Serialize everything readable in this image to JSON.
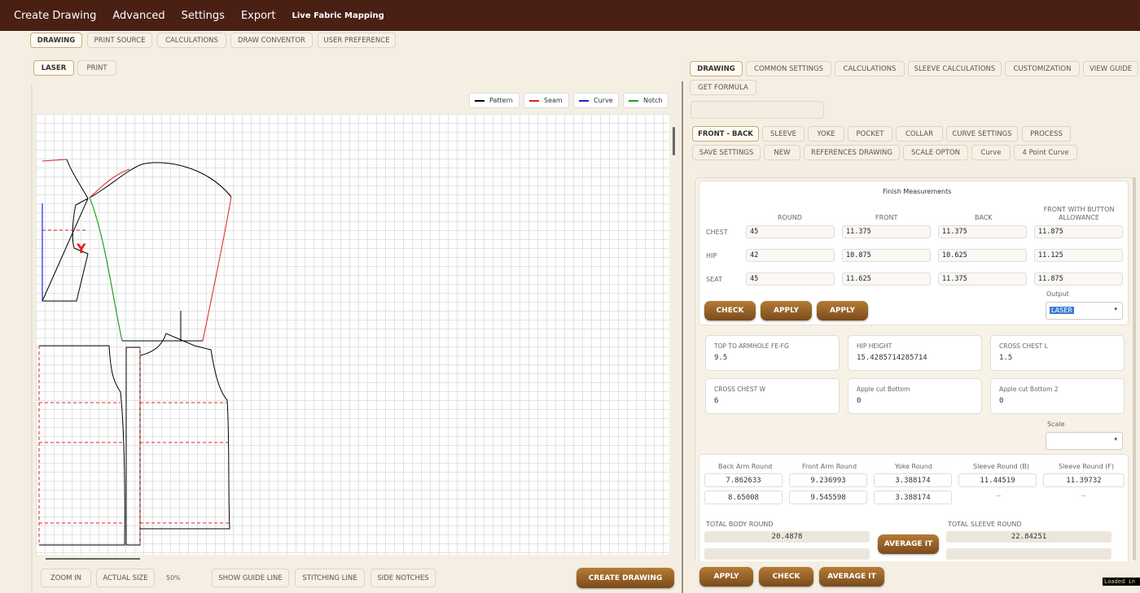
{
  "menu": {
    "create_drawing": "Create Drawing",
    "advanced": "Advanced",
    "settings": "Settings",
    "export": "Export",
    "live_fabric": "Live Fabric Mapping"
  },
  "top_tabs": [
    "DRAWING",
    "PRINT SOURCE",
    "CALCULATIONS",
    "DRAW CONVENTOR",
    "USER PREFERENCE"
  ],
  "mode_tabs": [
    "LASER",
    "PRINT"
  ],
  "legend": [
    "Pattern",
    "Seam",
    "Curve",
    "Notch"
  ],
  "legend_colors": {
    "pattern": "#000000",
    "seam": "#e02020",
    "curve": "#2020e0",
    "notch": "#20a020"
  },
  "drawing_marker": "Y",
  "bottom_bar": {
    "zoom_in": "ZOOM IN",
    "actual_size": "ACTUAL SIZE",
    "zoom": "50%",
    "show_guide": "SHOW GUIDE LINE",
    "stitching": "STITCHING LINE",
    "side_notches": "SIDE NOTCHES",
    "create": "CREATE DRAWING"
  },
  "right_tabs": [
    "DRAWING",
    "COMMON SETTINGS",
    "CALCULATIONS",
    "SLEEVE CALCULATIONS",
    "CUSTOMIZATION",
    "VIEW GUIDE",
    "GET FORMULA"
  ],
  "sub_tabs_row1": [
    "FRONT - BACK",
    "SLEEVE",
    "YOKE",
    "POCKET",
    "COLLAR",
    "CURVE SETTINGS",
    "PROCESS"
  ],
  "sub_tabs_row2": [
    "SAVE SETTINGS",
    "NEW",
    "REFERENCES DRAWING",
    "SCALE OPTON",
    "Curve",
    "4 Point Curve"
  ],
  "finish": {
    "title": "Finish Measurements",
    "headers": [
      "ROUND",
      "FRONT",
      "BACK",
      "FRONT WITH BUTTON ALLOWANCE"
    ],
    "rows": [
      {
        "label": "CHEST",
        "values": [
          "45",
          "11.375",
          "11.375",
          "11.875"
        ]
      },
      {
        "label": "HIP",
        "values": [
          "42",
          "10.875",
          "10.625",
          "11.125"
        ]
      },
      {
        "label": "SEAT",
        "values": [
          "45",
          "11.625",
          "11.375",
          "11.875"
        ]
      }
    ],
    "check": "CHECK",
    "apply1": "APPLY",
    "apply2": "APPLY",
    "output_label": "Output",
    "output_value": "LASER"
  },
  "cards": [
    {
      "title": "TOP TO ARMHOLE FE-FG",
      "value": "9.5"
    },
    {
      "title": "HIP HEIGHT",
      "value": "15.4285714285714"
    },
    {
      "title": "CROSS CHEST L",
      "value": "1.5"
    },
    {
      "title": "CROSS CHEST W",
      "value": "6"
    },
    {
      "title": "Apple cut Bottom",
      "value": "0"
    },
    {
      "title": "Apple cut Bottom 2",
      "value": "0"
    }
  ],
  "scale_label": "Scale",
  "rounds": {
    "headers": [
      "Back Arm Round",
      "Front Arm Round",
      "Yoke Round",
      "Sleeve Round (B)",
      "Sleeve Round (F)"
    ],
    "row1": [
      "7.862633",
      "9.236993",
      "3.388174",
      "11.44519",
      "11.39732"
    ],
    "row2": [
      "8.65008",
      "9.545598",
      "3.388174",
      "--",
      "--"
    ]
  },
  "totals": {
    "body_label": "TOTAL BODY ROUND",
    "body_value": "20.4878",
    "sleeve_label": "TOTAL SLEEVE ROUND",
    "sleeve_value": "22.84251",
    "average": "AVERAGE IT"
  },
  "right_bottom": {
    "apply": "APPLY",
    "check": "CHECK",
    "average": "AVERAGE IT"
  },
  "status": "Loaded in"
}
